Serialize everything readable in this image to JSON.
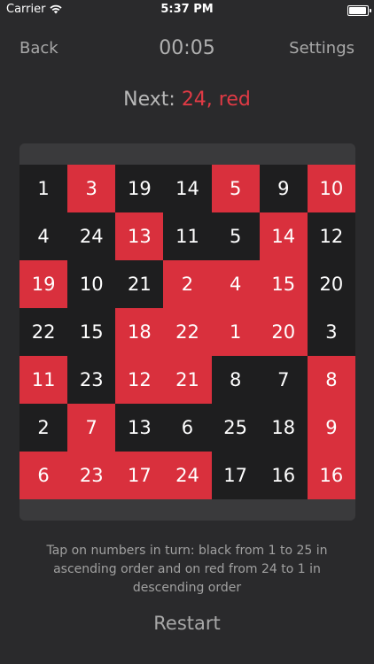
{
  "status_bar": {
    "carrier": "Carrier",
    "time": "5:37 PM",
    "icons": [
      "wifi-icon",
      "battery-icon"
    ]
  },
  "nav": {
    "back_label": "Back",
    "timer": "00:05",
    "settings_label": "Settings"
  },
  "next": {
    "label": "Next:",
    "value": "24, red"
  },
  "colors": {
    "red": "#d9303d",
    "black": "#1e1e1f",
    "accent": "#e03a45"
  },
  "board": {
    "rows": [
      [
        {
          "n": "1",
          "c": "black"
        },
        {
          "n": "3",
          "c": "red"
        },
        {
          "n": "19",
          "c": "black"
        },
        {
          "n": "14",
          "c": "black"
        },
        {
          "n": "5",
          "c": "red"
        },
        {
          "n": "9",
          "c": "black"
        },
        {
          "n": "10",
          "c": "red"
        }
      ],
      [
        {
          "n": "4",
          "c": "black"
        },
        {
          "n": "24",
          "c": "black"
        },
        {
          "n": "13",
          "c": "red"
        },
        {
          "n": "11",
          "c": "black"
        },
        {
          "n": "5",
          "c": "black"
        },
        {
          "n": "14",
          "c": "red"
        },
        {
          "n": "12",
          "c": "black"
        }
      ],
      [
        {
          "n": "19",
          "c": "red"
        },
        {
          "n": "10",
          "c": "black"
        },
        {
          "n": "21",
          "c": "black"
        },
        {
          "n": "2",
          "c": "red"
        },
        {
          "n": "4",
          "c": "red"
        },
        {
          "n": "15",
          "c": "red"
        },
        {
          "n": "20",
          "c": "black"
        }
      ],
      [
        {
          "n": "22",
          "c": "black"
        },
        {
          "n": "15",
          "c": "black"
        },
        {
          "n": "18",
          "c": "red"
        },
        {
          "n": "22",
          "c": "red"
        },
        {
          "n": "1",
          "c": "red"
        },
        {
          "n": "20",
          "c": "red"
        },
        {
          "n": "3",
          "c": "black"
        }
      ],
      [
        {
          "n": "11",
          "c": "red"
        },
        {
          "n": "23",
          "c": "black"
        },
        {
          "n": "12",
          "c": "red"
        },
        {
          "n": "21",
          "c": "red"
        },
        {
          "n": "8",
          "c": "black"
        },
        {
          "n": "7",
          "c": "black"
        },
        {
          "n": "8",
          "c": "red"
        }
      ],
      [
        {
          "n": "2",
          "c": "black"
        },
        {
          "n": "7",
          "c": "red"
        },
        {
          "n": "13",
          "c": "black"
        },
        {
          "n": "6",
          "c": "black"
        },
        {
          "n": "25",
          "c": "black"
        },
        {
          "n": "18",
          "c": "black"
        },
        {
          "n": "9",
          "c": "red"
        }
      ],
      [
        {
          "n": "6",
          "c": "red"
        },
        {
          "n": "23",
          "c": "red"
        },
        {
          "n": "17",
          "c": "red"
        },
        {
          "n": "24",
          "c": "red"
        },
        {
          "n": "17",
          "c": "black"
        },
        {
          "n": "16",
          "c": "black"
        },
        {
          "n": "16",
          "c": "red"
        }
      ]
    ]
  },
  "instructions": "Tap on numbers in turn: black from 1 to 25 in ascending order and on red from 24 to 1 in descending order",
  "restart_label": "Restart"
}
